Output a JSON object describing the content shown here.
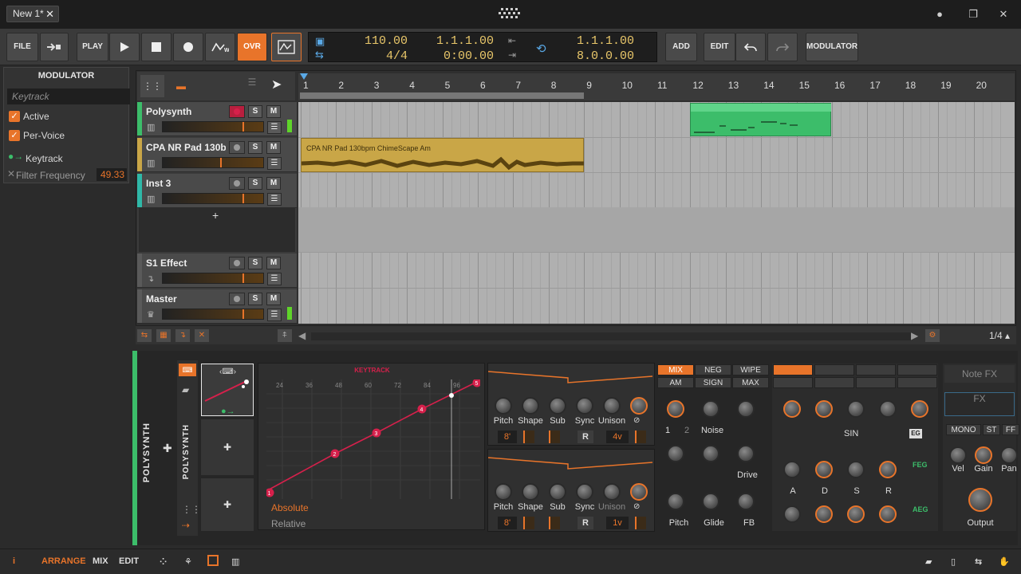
{
  "window": {
    "tab_label": "New 1*",
    "close_tab": "✕",
    "logo": "grid-logo-icon",
    "controls": [
      "●",
      "❐",
      "✕"
    ]
  },
  "toolbar": {
    "file": "FILE",
    "play_label": "PLAY",
    "ovr": "OVR",
    "tempo": "110.00",
    "signature": "4/4",
    "position_bars": "1.1.1.00",
    "position_time": "0:00.00",
    "loop_start": "1.1.1.00",
    "loop_length": "8.0.0.00",
    "add": "ADD",
    "edit": "EDIT",
    "modulator": "MODULATOR"
  },
  "modulator_panel": {
    "title": "MODULATOR",
    "placeholder": "Keytrack",
    "active": "Active",
    "per_voice": "Per-Voice",
    "source": "Keytrack",
    "target": "Filter Frequency",
    "amount": "49.33"
  },
  "tracks": [
    {
      "name": "Polysynth",
      "color": "#3cbd6a"
    },
    {
      "name": "CPA NR Pad 130b...",
      "color": "#c9a647"
    },
    {
      "name": "Inst 3",
      "color": "#2fb8a8"
    },
    {
      "name": "S1 Effect",
      "color": "#5a5a5a"
    },
    {
      "name": "Master",
      "color": "#5a5a5a"
    }
  ],
  "track_buttons": {
    "solo": "S",
    "mute": "M",
    "add_track": "+"
  },
  "ruler": {
    "bars": [
      "1",
      "2",
      "3",
      "4",
      "5",
      "6",
      "7",
      "8",
      "9",
      "10",
      "11",
      "12",
      "13",
      "14",
      "15",
      "16",
      "17",
      "18",
      "19",
      "20"
    ]
  },
  "clips": {
    "audio_label": "CPA NR Pad 130bpm ChimeScape Am"
  },
  "arranger_footer": {
    "zoom": "1/4 ▴"
  },
  "device": {
    "name": "POLYSYNTH",
    "sub_name": "POLYSYNTH",
    "keytrack_title": "KEYTRACK",
    "grid_labels": [
      "24",
      "36",
      "48",
      "60",
      "72",
      "84",
      "96"
    ],
    "points": [
      "1",
      "2",
      "3",
      "4",
      "5"
    ],
    "mode_absolute": "Absolute",
    "mode_relative": "Relative",
    "osc_labels": [
      "Pitch",
      "Shape",
      "Sub",
      "Sync",
      "Unison"
    ],
    "osc1": {
      "oct": "8'",
      "r": "R",
      "voices": "4v"
    },
    "osc2": {
      "oct": "8'",
      "r": "R",
      "voices": "1v"
    },
    "mix_modes": [
      "MIX",
      "NEG",
      "WIPE",
      "AM",
      "SIGN",
      "MAX"
    ],
    "mixer_labels": {
      "noise": "Noise",
      "drive": "Drive",
      "pitch": "Pitch",
      "glide": "Glide",
      "fb": "FB",
      "one": "1",
      "two": "2"
    },
    "filter_labels": {
      "sin": "SIN",
      "eg": "EG",
      "a": "A",
      "d": "D",
      "s": "S",
      "r": "R",
      "feg": "FEG",
      "aeg": "AEG"
    },
    "note_fx": "Note FX",
    "fx": "FX",
    "out_modes": [
      "MONO",
      "ST",
      "FF"
    ],
    "out_labels": {
      "vel": "Vel",
      "gain": "Gain",
      "pan": "Pan",
      "output": "Output"
    }
  },
  "bottom": {
    "info": "i",
    "arrange": "ARRANGE",
    "mix": "MIX",
    "edit": "EDIT"
  },
  "colors": {
    "accent": "#e8742a",
    "green": "#3cbd6a",
    "gold": "#c9a647",
    "red": "#d6204b"
  }
}
